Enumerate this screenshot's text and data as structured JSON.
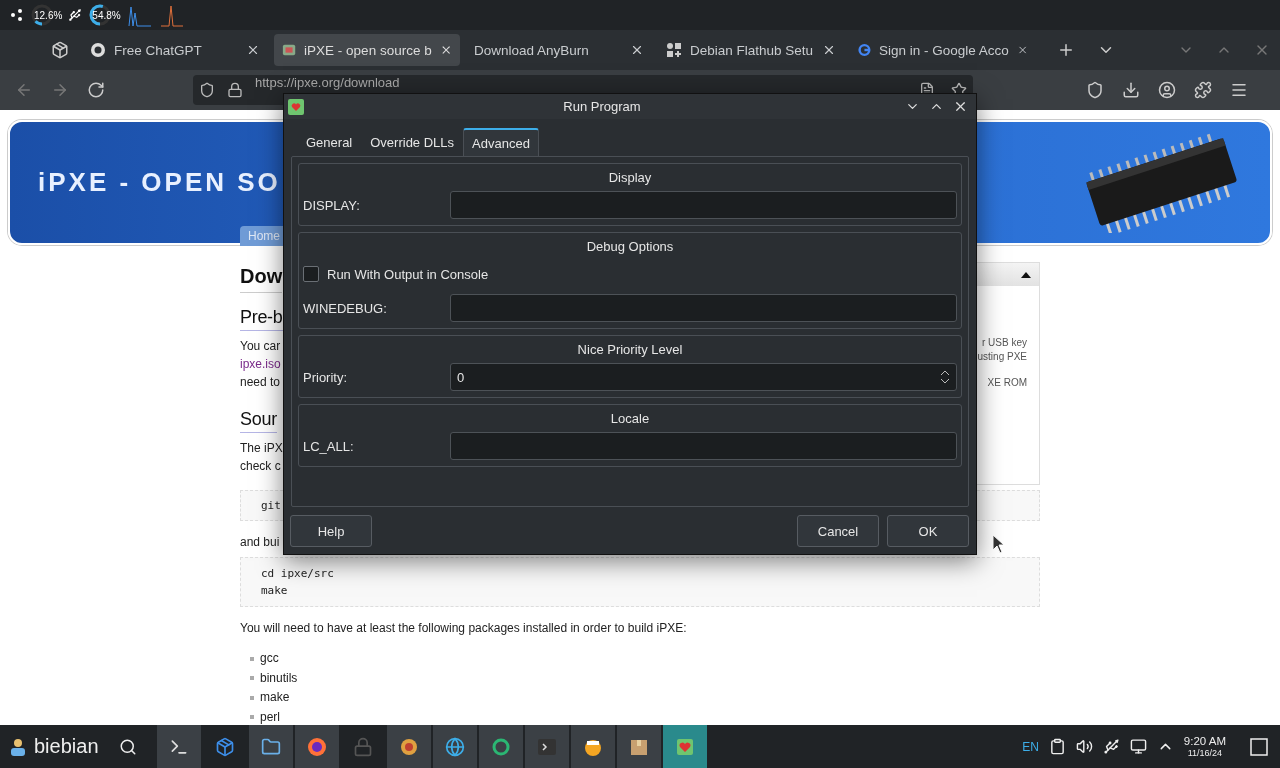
{
  "top_panel": {
    "meters": [
      {
        "reading": "12.6%"
      },
      {
        "reading": "54.8%"
      }
    ]
  },
  "browser": {
    "tabs": [
      {
        "title": "Free ChatGPT",
        "selected": false
      },
      {
        "title": "iPXE - open source b",
        "selected": true
      },
      {
        "title": "Download AnyBurn",
        "selected": false
      },
      {
        "title": "Debian Flathub Setu",
        "selected": false
      },
      {
        "title": "Sign in - Google Acco",
        "selected": false
      }
    ],
    "url": "https://ipxe.org/download"
  },
  "page": {
    "banner_title": "iPXE - OPEN SO",
    "nav_tab": "Home",
    "intro": [
      {
        "kind": "h1",
        "text": "Dow"
      },
      {
        "kind": "h2",
        "text": "Pre-b"
      },
      {
        "kind": "p",
        "text": "You car"
      },
      {
        "kind": "link",
        "text": "ipxe.iso"
      },
      {
        "kind": "p",
        "text": "need to"
      },
      {
        "kind": "h2",
        "text": "Sour"
      },
      {
        "kind": "p",
        "text": "The iPX"
      },
      {
        "kind": "p",
        "text": "check c"
      }
    ],
    "sidebar": [
      "r USB key",
      "usting PXE",
      "XE ROM"
    ],
    "code_1": [
      "git"
    ],
    "after_code": "and bui",
    "code_2": [
      "cd ipxe/src",
      "make"
    ],
    "packages_intro": "You will need to have at least the following packages installed in order to build iPXE:",
    "packages": [
      "gcc",
      "binutils",
      "make",
      "perl"
    ]
  },
  "dialog": {
    "title": "Run Program",
    "tabs": [
      {
        "label": "General",
        "selected": false
      },
      {
        "label": "Override DLLs",
        "selected": false
      },
      {
        "label": "Advanced",
        "selected": true
      }
    ],
    "groups": [
      {
        "title": "Display",
        "rows": [
          {
            "kind": "field",
            "label": "DISPLAY:"
          }
        ]
      },
      {
        "title": "Debug Options",
        "rows": [
          {
            "kind": "checkbox",
            "label": "Run With Output in Console",
            "checked": false
          },
          {
            "kind": "field",
            "label": "WINEDEBUG:"
          }
        ]
      },
      {
        "title": "Nice Priority Level",
        "rows": [
          {
            "kind": "spin",
            "label": "Priority:",
            "value": "0"
          }
        ]
      },
      {
        "title": "Locale",
        "rows": [
          {
            "kind": "field",
            "label": "LC_ALL:"
          }
        ]
      }
    ],
    "buttons": [
      {
        "label": "Help"
      },
      {
        "label": "Cancel"
      },
      {
        "label": "OK"
      }
    ]
  },
  "taskbar": {
    "start_label": "biebian",
    "apps": [
      {
        "running": true,
        "selected": false
      },
      {
        "running": false,
        "selected": false
      },
      {
        "running": true,
        "selected": false
      },
      {
        "running": true,
        "selected": false
      },
      {
        "running": false,
        "selected": false
      },
      {
        "running": true,
        "selected": false
      },
      {
        "running": true,
        "selected": false
      },
      {
        "running": true,
        "selected": false
      },
      {
        "running": true,
        "selected": false
      },
      {
        "running": true,
        "selected": false
      },
      {
        "running": true,
        "selected": false
      },
      {
        "running": true,
        "selected": true
      }
    ],
    "language": "EN",
    "time": "9:20 AM",
    "date": "11/16/24"
  }
}
